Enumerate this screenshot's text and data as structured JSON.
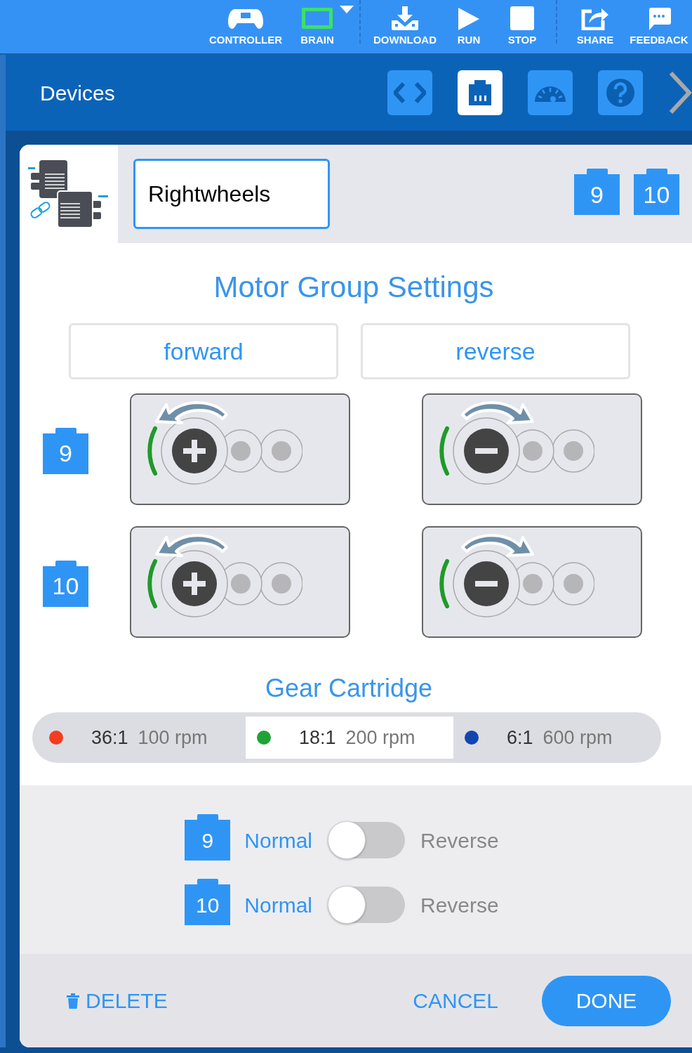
{
  "toolbar": {
    "items": [
      {
        "kind": "controller",
        "label": "CONTROLLER"
      },
      {
        "kind": "brain",
        "label": "BRAIN"
      },
      {
        "kind": "divider"
      },
      {
        "kind": "download",
        "label": "DOWNLOAD"
      },
      {
        "kind": "run",
        "label": "RUN"
      },
      {
        "kind": "stop",
        "label": "STOP"
      },
      {
        "kind": "divider"
      },
      {
        "kind": "share",
        "label": "SHARE"
      },
      {
        "kind": "feedback",
        "label": "FEEDBACK"
      }
    ]
  },
  "header": {
    "title": "Devices",
    "tabs": [
      {
        "kind": "code",
        "selected": false
      },
      {
        "kind": "devices",
        "selected": true
      },
      {
        "kind": "dashboard",
        "selected": false
      },
      {
        "kind": "help",
        "selected": false
      }
    ]
  },
  "device": {
    "name": "Rightwheels",
    "ports": [
      "9",
      "10"
    ]
  },
  "settings": {
    "title": "Motor Group Settings",
    "direction_buttons": [
      "forward",
      "reverse"
    ],
    "motor_rows": [
      {
        "port": "9",
        "tiles": [
          {
            "kind": "forward"
          },
          {
            "kind": "reverse"
          }
        ]
      },
      {
        "port": "10",
        "tiles": [
          {
            "kind": "forward"
          },
          {
            "kind": "reverse"
          }
        ]
      }
    ]
  },
  "gear_cartridge": {
    "title": "Gear Cartridge",
    "options": [
      {
        "ratio": "36:1",
        "speed": "100 rpm",
        "color": "#f43d1f",
        "selected": false
      },
      {
        "ratio": "18:1",
        "speed": "200 rpm",
        "color": "#1fa336",
        "selected": true
      },
      {
        "ratio": "6:1",
        "speed": "600 rpm",
        "color": "#1245b0",
        "selected": false
      }
    ]
  },
  "direction_toggles": [
    {
      "port": "9",
      "left_label": "Normal",
      "right_label": "Reverse",
      "on": false
    },
    {
      "port": "10",
      "left_label": "Normal",
      "right_label": "Reverse",
      "on": false
    }
  ],
  "footer": {
    "delete": "DELETE",
    "cancel": "CANCEL",
    "done": "DONE"
  }
}
